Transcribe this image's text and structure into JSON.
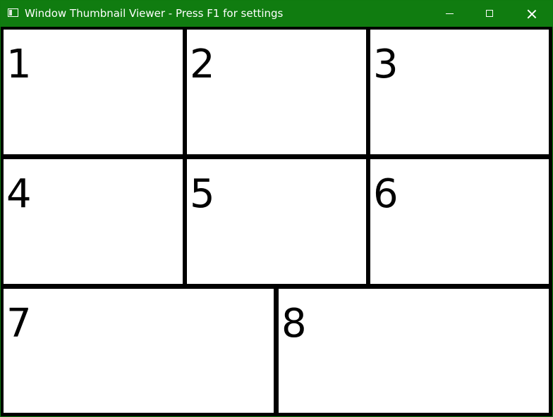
{
  "window": {
    "title": "Window Thumbnail Viewer - Press F1 for settings",
    "titlebar_color": "#107c10",
    "app_icon": "window-icon",
    "controls": {
      "minimize_icon": "minimize-icon",
      "maximize_icon": "maximize-icon",
      "close_icon": "close-icon"
    }
  },
  "thumbnails": [
    {
      "label": "1"
    },
    {
      "label": "2"
    },
    {
      "label": "3"
    },
    {
      "label": "4"
    },
    {
      "label": "5"
    },
    {
      "label": "6"
    },
    {
      "label": "7"
    },
    {
      "label": "8"
    }
  ]
}
